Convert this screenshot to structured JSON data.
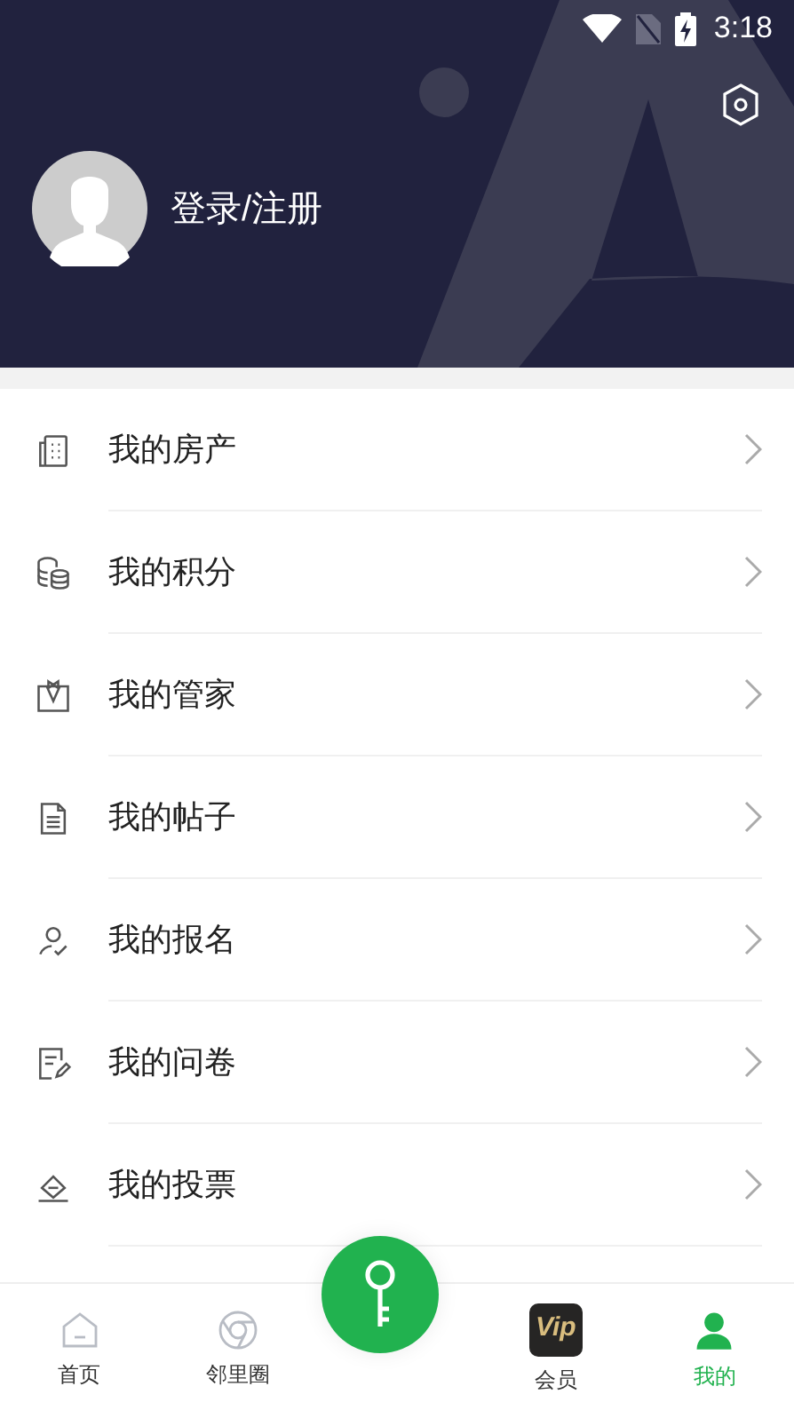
{
  "status_bar": {
    "time": "3:18"
  },
  "profile": {
    "login_label": "登录/注册"
  },
  "menu": [
    {
      "kind": "building",
      "label": "我的房产"
    },
    {
      "kind": "coins",
      "label": "我的积分"
    },
    {
      "kind": "butler",
      "label": "我的管家"
    },
    {
      "kind": "document",
      "label": "我的帖子"
    },
    {
      "kind": "person-check",
      "label": "我的报名"
    },
    {
      "kind": "form",
      "label": "我的问卷"
    },
    {
      "kind": "ballot",
      "label": "我的投票"
    }
  ],
  "bottom_nav": [
    {
      "kind": "home",
      "label": "首页",
      "selected": false
    },
    {
      "kind": "circle",
      "label": "邻里圈",
      "selected": false
    },
    {
      "kind": "key",
      "selected": false
    },
    {
      "kind": "vip",
      "label": "会员",
      "badge": "Vip",
      "selected": false
    },
    {
      "kind": "me",
      "label": "我的",
      "selected": true
    }
  ]
}
